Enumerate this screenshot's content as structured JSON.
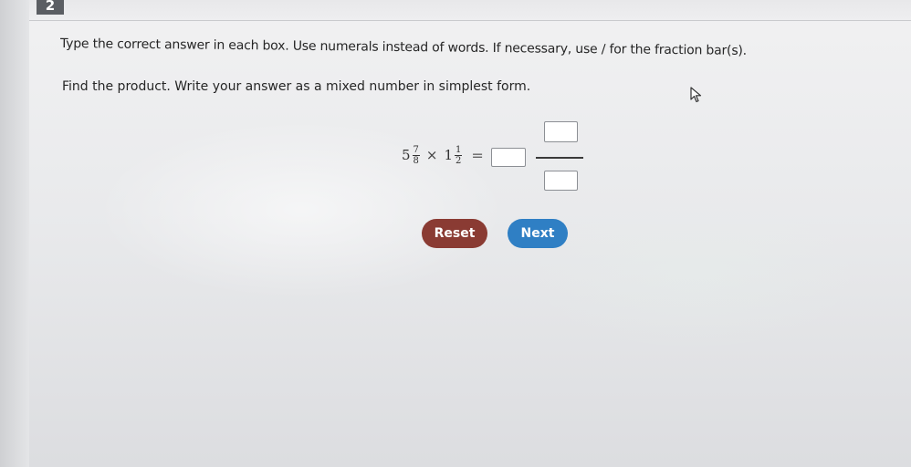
{
  "header": {
    "question_number": "2"
  },
  "question": {
    "instruction": "Type the correct answer in each box. Use numerals instead of words. If necessary, use / for the fraction bar(s).",
    "prompt": "Find the product. Write your answer as a mixed number in simplest form.",
    "expression": {
      "term1": {
        "whole": "5",
        "numerator": "7",
        "denominator": "8"
      },
      "operator": "×",
      "term2": {
        "whole": "1",
        "numerator": "1",
        "denominator": "2"
      },
      "equals": "="
    },
    "answer": {
      "whole_value": "",
      "numerator_value": "",
      "denominator_value": ""
    }
  },
  "buttons": {
    "reset_label": "Reset",
    "next_label": "Next"
  },
  "colors": {
    "reset_button": "#8a3b33",
    "next_button": "#2f7fc4"
  },
  "icons": {
    "pointer": "mouse-pointer-icon"
  }
}
